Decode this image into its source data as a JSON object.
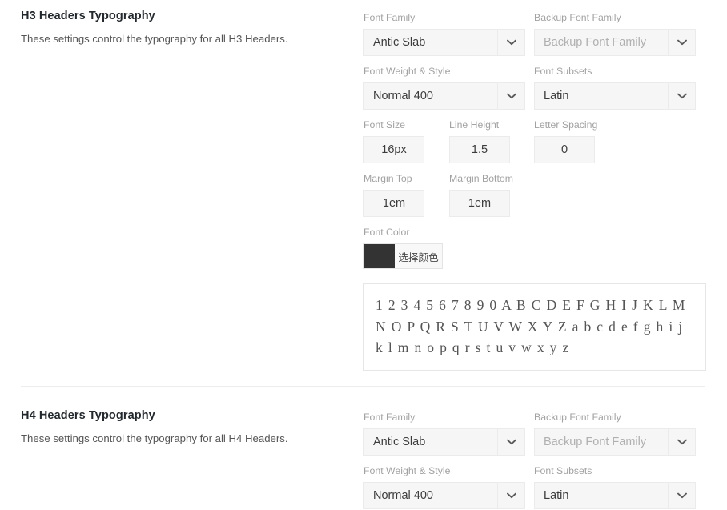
{
  "page": {
    "background": "#ffffff",
    "accent_color": "#333333"
  },
  "sections": [
    {
      "id": "h3-headers-typography",
      "title": "H3 Headers Typography",
      "subtitle": "These settings control the typography for all H3 Headers.",
      "fields": {
        "font_family": {
          "label": "Font Family",
          "value": "Antic Slab",
          "is_placeholder": false
        },
        "backup_font_family": {
          "label": "Backup Font Family",
          "value": "Backup Font Family",
          "is_placeholder": true
        },
        "font_weight_style": {
          "label": "Font Weight & Style",
          "value": "Normal 400",
          "is_placeholder": false
        },
        "font_subsets": {
          "label": "Font Subsets",
          "value": "Latin",
          "is_placeholder": false
        },
        "font_size": {
          "label": "Font Size",
          "value": "16px"
        },
        "line_height": {
          "label": "Line Height",
          "value": "1.5"
        },
        "letter_spacing": {
          "label": "Letter Spacing",
          "value": "0"
        },
        "margin_top": {
          "label": "Margin Top",
          "value": "1em"
        },
        "margin_bottom": {
          "label": "Margin Bottom",
          "value": "1em"
        },
        "font_color": {
          "label": "Font Color",
          "button_label": "选择颜色",
          "swatch_color": "#333333"
        },
        "preview": {
          "text": "1 2 3 4 5 6 7 8 9 0 A B C D E F G H I J K L M N O P Q R S T U V W X Y Z a b c d e f g h i j k l m n o p q r s t u v w x y z"
        }
      }
    },
    {
      "id": "h4-headers-typography",
      "title": "H4 Headers Typography",
      "subtitle": "These settings control the typography for all H4 Headers.",
      "fields": {
        "font_family": {
          "label": "Font Family",
          "value": "Antic Slab",
          "is_placeholder": false
        },
        "backup_font_family": {
          "label": "Backup Font Family",
          "value": "Backup Font Family",
          "is_placeholder": true
        },
        "font_weight_style": {
          "label": "Font Weight & Style",
          "value": "Normal 400",
          "is_placeholder": false
        },
        "font_subsets": {
          "label": "Font Subsets",
          "value": "Latin",
          "is_placeholder": false
        }
      }
    }
  ],
  "icons": {
    "chevron_down": "chevron-down-icon"
  }
}
